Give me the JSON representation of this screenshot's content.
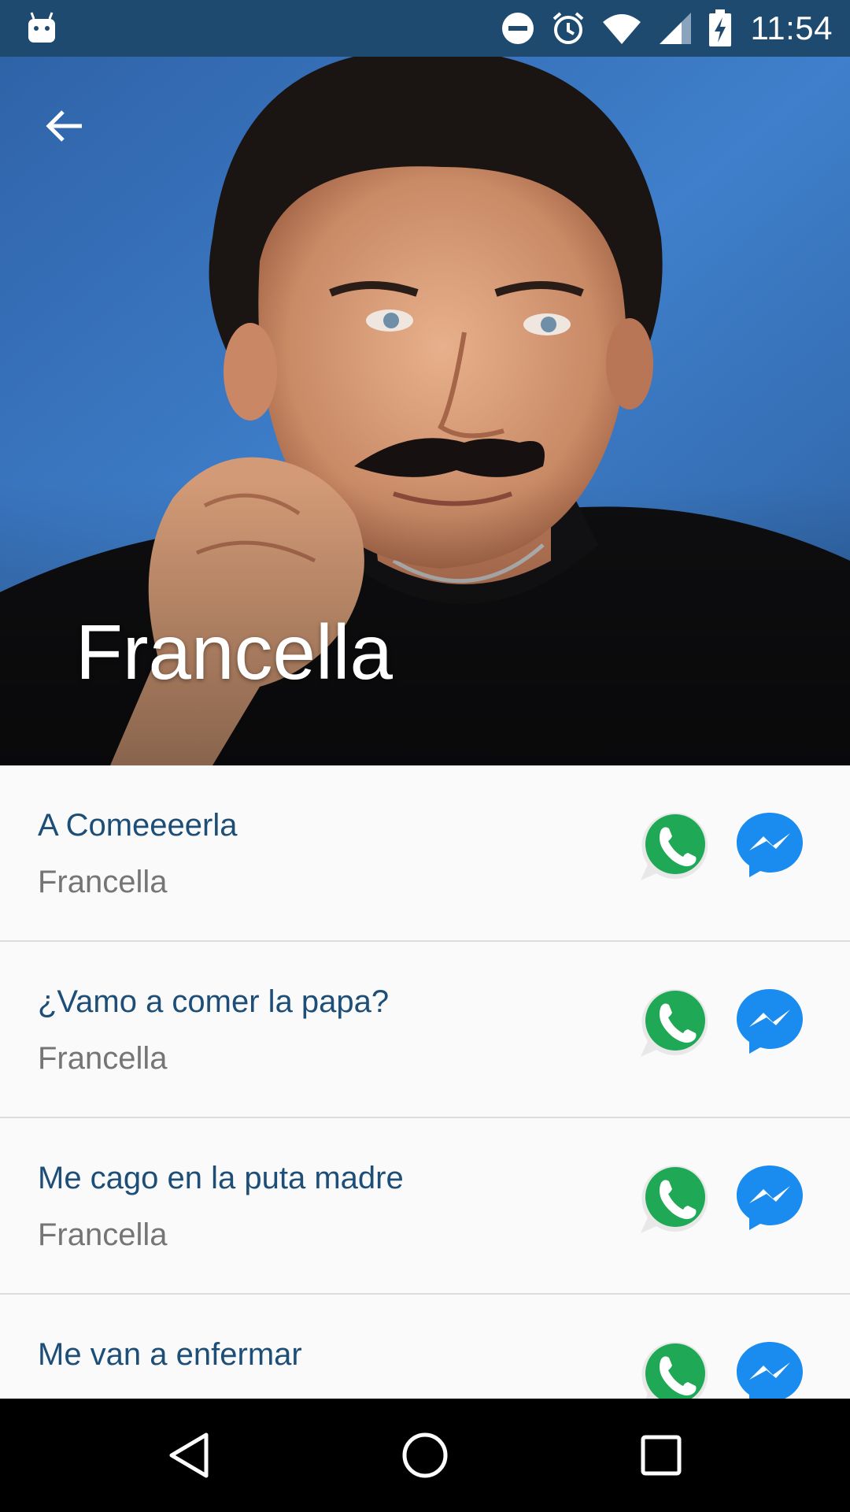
{
  "status_bar": {
    "time": "11:54",
    "icons": [
      "android-icon",
      "do-not-disturb-icon",
      "alarm-icon",
      "wifi-icon",
      "cell-signal-icon",
      "battery-charging-icon"
    ]
  },
  "hero": {
    "title": "Francella",
    "back_icon": "arrow-back-icon",
    "photo": "portrait-photo"
  },
  "list": {
    "items": [
      {
        "title": "A Comeeeerla",
        "subtitle": "Francella"
      },
      {
        "title": "¿Vamo a comer la papa?",
        "subtitle": "Francella"
      },
      {
        "title": "Me cago en la puta madre",
        "subtitle": "Francella"
      },
      {
        "title": "Me van a enfermar",
        "subtitle": ""
      }
    ],
    "share_icons": [
      "whatsapp-icon",
      "messenger-icon"
    ]
  },
  "nav_bar": {
    "icons": [
      "back-triangle-icon",
      "home-circle-icon",
      "recents-square-icon"
    ]
  },
  "colors": {
    "status_bar": "#1f4a70",
    "title_text": "#1d4e78",
    "subtitle_text": "#757575",
    "whatsapp": "#1fa855",
    "messenger": "#1a8cf0",
    "hero_bg": "#3a78c4"
  }
}
